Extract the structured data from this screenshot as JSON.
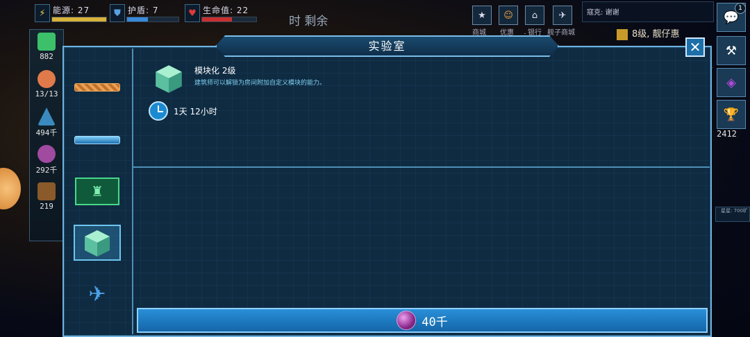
{
  "topbar": {
    "energy": {
      "label": "能源: 27",
      "icon": "lightning-icon",
      "fill": 1.0
    },
    "shield": {
      "label": "护盾: 7",
      "icon": "shield-icon",
      "fill": 0.4
    },
    "hp": {
      "label": "生命值: 22",
      "icon": "heart-icon",
      "fill": 0.55
    },
    "remain": "时 剩余",
    "shortcuts": [
      {
        "label": "商城",
        "icon": "star-icon"
      },
      {
        "label": "优惠",
        "icon": "face-icon"
      },
      {
        "label": "银行",
        "icon": "bank-icon"
      },
      {
        "label": "舰子商城",
        "icon": "ship-icon"
      }
    ],
    "chat": "寇克: 谢谢",
    "promo": "8级, 靓仔惠"
  },
  "left_resources": [
    {
      "icon": "cash-icon",
      "value": "882",
      "color": "#3cc06a"
    },
    {
      "icon": "crew-icon",
      "value": "13/13",
      "color": "#e07a4a"
    },
    {
      "icon": "mineral-icon",
      "value": "494千",
      "color": "#3a8ac0"
    },
    {
      "icon": "gas-icon",
      "value": "292千",
      "color": "#a04aa0"
    },
    {
      "icon": "crate-icon",
      "value": "219",
      "color": "#8a5a2a"
    }
  ],
  "right_bar": {
    "chat_badge": "1",
    "trophy_value": "2412",
    "tiny_label": "星星: 700旷"
  },
  "dialog": {
    "title": "实验室",
    "close": "✕",
    "research": {
      "name": "模块化 2级",
      "description": "建筑师可以解锁为房间附加自定义模块的能力。",
      "duration": "1天 12小时"
    },
    "categories": [
      {
        "name": "rope-rod",
        "selected": false
      },
      {
        "name": "blue-rod",
        "selected": false
      },
      {
        "name": "robot-screen",
        "selected": false
      },
      {
        "name": "module-cube",
        "selected": true
      },
      {
        "name": "unknown-ship",
        "selected": false
      }
    ],
    "buy": {
      "price": "40千",
      "currency_icon": "gas-orb-icon"
    }
  },
  "colors": {
    "accent": "#6fb2df",
    "button": "#1e7cc4",
    "panel": "#0f2b42"
  }
}
